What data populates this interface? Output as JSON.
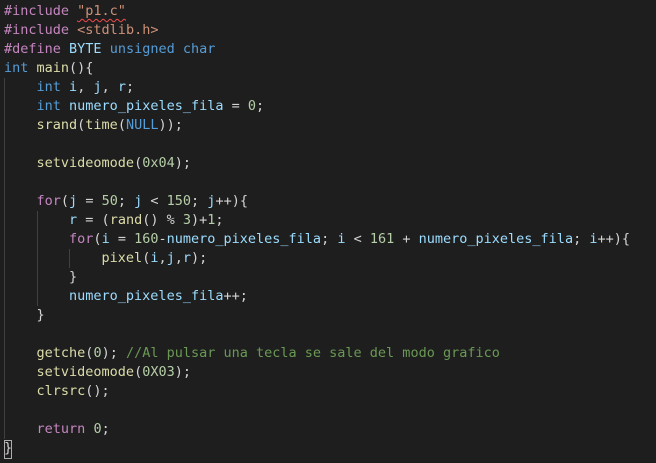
{
  "editor": {
    "lines": [
      [
        {
          "t": "#include",
          "c": "kw-purple"
        },
        {
          "t": " "
        },
        {
          "t": "\"p1.c\"",
          "c": "str squiggle"
        }
      ],
      [
        {
          "t": "#include",
          "c": "kw-purple"
        },
        {
          "t": " "
        },
        {
          "t": "<stdlib.h>",
          "c": "str"
        }
      ],
      [
        {
          "t": "#define",
          "c": "kw-purple"
        },
        {
          "t": " "
        },
        {
          "t": "BYTE",
          "c": "var"
        },
        {
          "t": " "
        },
        {
          "t": "unsigned",
          "c": "kw-blue"
        },
        {
          "t": " "
        },
        {
          "t": "char",
          "c": "kw-blue"
        }
      ],
      [
        {
          "t": "int",
          "c": "kw-blue"
        },
        {
          "t": " "
        },
        {
          "t": "main",
          "c": "fn"
        },
        {
          "t": "(){",
          "c": "pun"
        }
      ],
      [
        {
          "t": "    "
        },
        {
          "t": "int",
          "c": "kw-blue"
        },
        {
          "t": " "
        },
        {
          "t": "i",
          "c": "var"
        },
        {
          "t": ", "
        },
        {
          "t": "j",
          "c": "var"
        },
        {
          "t": ", "
        },
        {
          "t": "r",
          "c": "var"
        },
        {
          "t": ";"
        }
      ],
      [
        {
          "t": "    "
        },
        {
          "t": "int",
          "c": "kw-blue"
        },
        {
          "t": " "
        },
        {
          "t": "numero_pixeles_fila",
          "c": "var"
        },
        {
          "t": " = "
        },
        {
          "t": "0",
          "c": "num"
        },
        {
          "t": ";"
        }
      ],
      [
        {
          "t": "    "
        },
        {
          "t": "srand",
          "c": "fn"
        },
        {
          "t": "("
        },
        {
          "t": "time",
          "c": "fn"
        },
        {
          "t": "("
        },
        {
          "t": "NULL",
          "c": "kw-blue"
        },
        {
          "t": "));"
        }
      ],
      [],
      [
        {
          "t": "    "
        },
        {
          "t": "setvideomode",
          "c": "fn"
        },
        {
          "t": "("
        },
        {
          "t": "0x04",
          "c": "num"
        },
        {
          "t": ");"
        }
      ],
      [],
      [
        {
          "t": "    "
        },
        {
          "t": "for",
          "c": "kw-purple"
        },
        {
          "t": "("
        },
        {
          "t": "j",
          "c": "var"
        },
        {
          "t": " = "
        },
        {
          "t": "50",
          "c": "num"
        },
        {
          "t": "; "
        },
        {
          "t": "j",
          "c": "var"
        },
        {
          "t": " < "
        },
        {
          "t": "150",
          "c": "num"
        },
        {
          "t": "; "
        },
        {
          "t": "j",
          "c": "var"
        },
        {
          "t": "++){"
        }
      ],
      [
        {
          "t": "        "
        },
        {
          "t": "r",
          "c": "var"
        },
        {
          "t": " = ("
        },
        {
          "t": "rand",
          "c": "fn"
        },
        {
          "t": "() % "
        },
        {
          "t": "3",
          "c": "num"
        },
        {
          "t": ")+"
        },
        {
          "t": "1",
          "c": "num"
        },
        {
          "t": ";"
        }
      ],
      [
        {
          "t": "        "
        },
        {
          "t": "for",
          "c": "kw-purple"
        },
        {
          "t": "("
        },
        {
          "t": "i",
          "c": "var"
        },
        {
          "t": " = "
        },
        {
          "t": "160",
          "c": "num"
        },
        {
          "t": "-"
        },
        {
          "t": "numero_pixeles_fila",
          "c": "var"
        },
        {
          "t": "; "
        },
        {
          "t": "i",
          "c": "var"
        },
        {
          "t": " < "
        },
        {
          "t": "161",
          "c": "num"
        },
        {
          "t": " + "
        },
        {
          "t": "numero_pixeles_fila",
          "c": "var"
        },
        {
          "t": "; "
        },
        {
          "t": "i",
          "c": "var"
        },
        {
          "t": "++){"
        }
      ],
      [
        {
          "t": "            "
        },
        {
          "t": "pixel",
          "c": "fn"
        },
        {
          "t": "("
        },
        {
          "t": "i",
          "c": "var"
        },
        {
          "t": ","
        },
        {
          "t": "j",
          "c": "var"
        },
        {
          "t": ","
        },
        {
          "t": "r",
          "c": "var"
        },
        {
          "t": ");"
        }
      ],
      [
        {
          "t": "        }"
        }
      ],
      [
        {
          "t": "        "
        },
        {
          "t": "numero_pixeles_fila",
          "c": "var"
        },
        {
          "t": "++;"
        }
      ],
      [
        {
          "t": "    }"
        }
      ],
      [],
      [
        {
          "t": "    "
        },
        {
          "t": "getche",
          "c": "fn"
        },
        {
          "t": "("
        },
        {
          "t": "0",
          "c": "num"
        },
        {
          "t": "); "
        },
        {
          "t": "//Al pulsar una tecla se sale del modo grafico",
          "c": "cmt"
        }
      ],
      [
        {
          "t": "    "
        },
        {
          "t": "setvideomode",
          "c": "fn"
        },
        {
          "t": "("
        },
        {
          "t": "0X03",
          "c": "num"
        },
        {
          "t": ");"
        }
      ],
      [
        {
          "t": "    "
        },
        {
          "t": "clrsrc",
          "c": "fn"
        },
        {
          "t": "();"
        }
      ],
      [],
      [
        {
          "t": "    "
        },
        {
          "t": "return",
          "c": "kw-purple"
        },
        {
          "t": " "
        },
        {
          "t": "0",
          "c": "num"
        },
        {
          "t": ";"
        }
      ],
      [
        {
          "t": "}"
        }
      ]
    ]
  }
}
